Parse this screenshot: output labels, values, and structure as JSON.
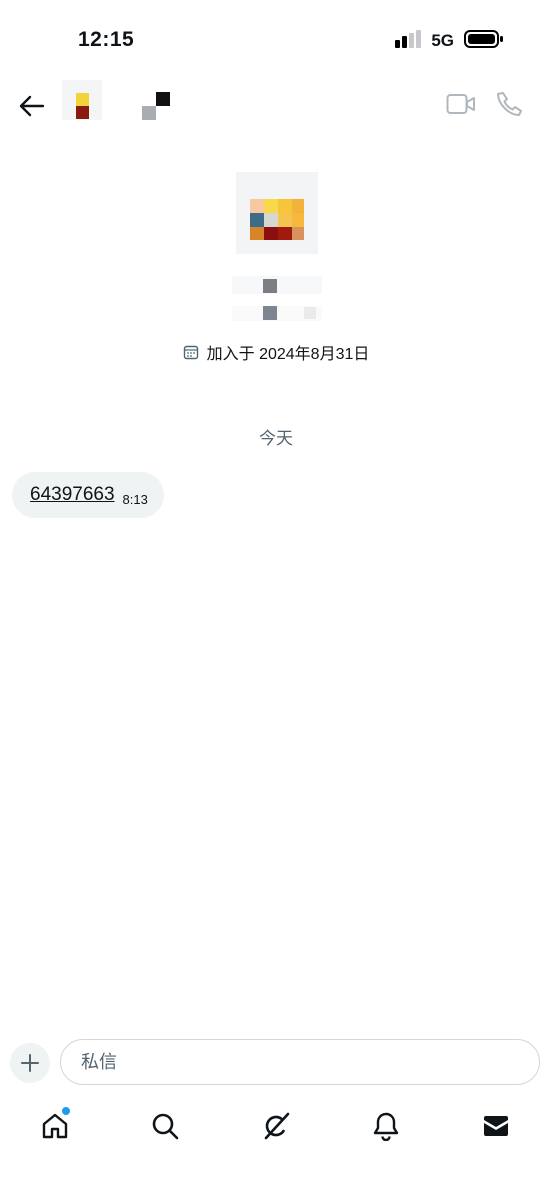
{
  "status_bar": {
    "time": "12:15",
    "network": "5G"
  },
  "profile": {
    "joined_text": "加入于 2024年8月31日"
  },
  "chat": {
    "date_separator": "今天",
    "messages": [
      {
        "text": "64397663",
        "time": "8:13",
        "direction": "incoming"
      }
    ]
  },
  "composer": {
    "placeholder": "私信"
  },
  "bottom_nav": {
    "items": [
      {
        "icon": "home-icon",
        "has_notification_dot": true
      },
      {
        "icon": "search-icon"
      },
      {
        "icon": "grok-icon"
      },
      {
        "icon": "bell-icon"
      },
      {
        "icon": "mail-icon",
        "active": true
      }
    ]
  },
  "colors": {
    "accent": "#1d9bf0",
    "text": "#0f1419",
    "muted": "#536471",
    "bubble": "#eff3f4",
    "border": "#cfd9de"
  }
}
